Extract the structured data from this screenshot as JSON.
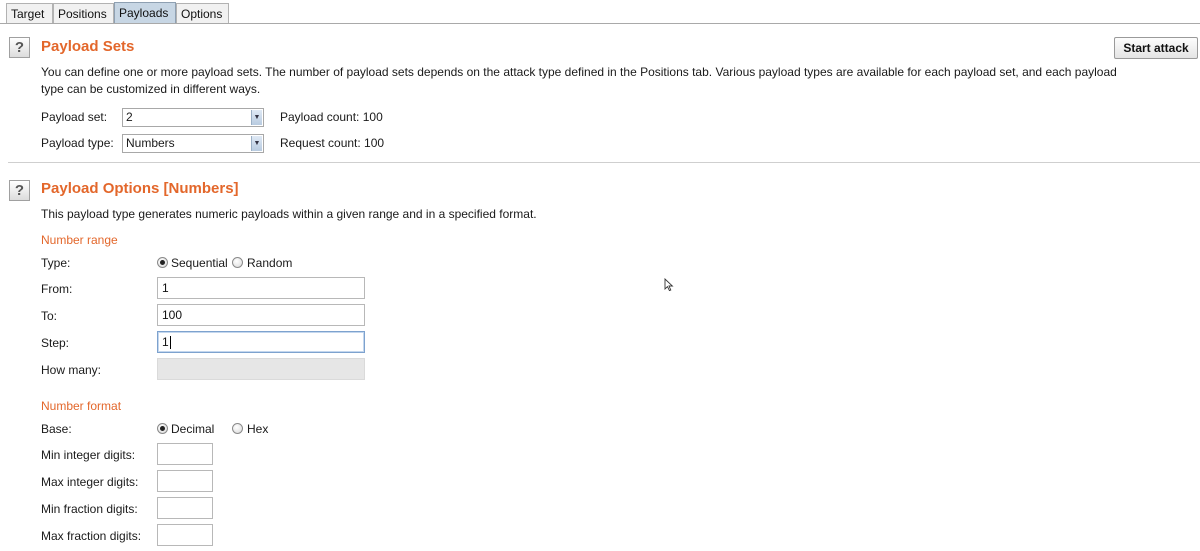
{
  "tabs": [
    {
      "label": "Target",
      "active": false
    },
    {
      "label": "Positions",
      "active": false
    },
    {
      "label": "Payloads",
      "active": true
    },
    {
      "label": "Options",
      "active": false
    }
  ],
  "help_glyph": "?",
  "payload_sets": {
    "title": "Payload Sets",
    "description": "You can define one or more payload sets. The number of payload sets depends on the attack type defined in the Positions tab. Various payload types are available for each payload set, and each payload type can be customized in different ways.",
    "start_attack_label": "Start attack",
    "set_label": "Payload set:",
    "set_value": "2",
    "type_label": "Payload type:",
    "type_value": "Numbers",
    "payload_count": "Payload count: 100",
    "request_count": "Request count: 100"
  },
  "payload_options": {
    "title": "Payload Options [Numbers]",
    "description": "This payload type generates numeric payloads within a given range and in a specified format.",
    "number_range": {
      "heading": "Number range",
      "type_label": "Type:",
      "sequential_label": "Sequential",
      "random_label": "Random",
      "selected": "Sequential",
      "from_label": "From:",
      "from_value": "1",
      "to_label": "To:",
      "to_value": "100",
      "step_label": "Step:",
      "step_value": "1",
      "how_many_label": "How many:",
      "how_many_value": ""
    },
    "number_format": {
      "heading": "Number format",
      "base_label": "Base:",
      "decimal_label": "Decimal",
      "hex_label": "Hex",
      "selected": "Decimal",
      "min_int_label": "Min integer digits:",
      "max_int_label": "Max integer digits:",
      "min_frac_label": "Min fraction digits:",
      "max_frac_label": "Max fraction digits:",
      "min_int_value": "",
      "max_int_value": "",
      "min_frac_value": "",
      "max_frac_value": ""
    }
  },
  "icons": {
    "dropdown": "chevron-down-icon",
    "cursor": "mouse-pointer-icon",
    "help": "help-icon"
  },
  "colors": {
    "section_title": "#e3672b",
    "active_tab": "#c7d6e4"
  }
}
